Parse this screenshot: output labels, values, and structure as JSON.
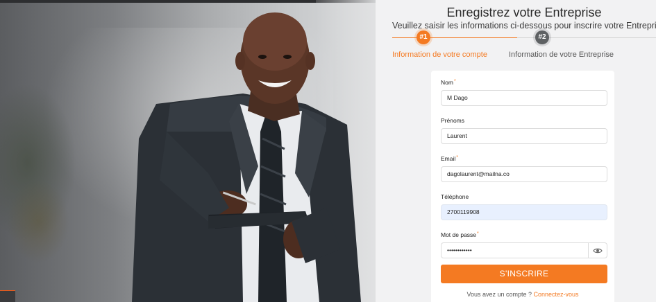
{
  "header": {
    "title": "Enregistrez votre Entreprise",
    "subtitle": "Veuillez saisir les informations ci-dessous pour inscrire votre Entreprise"
  },
  "steps": [
    {
      "number": "#1",
      "label": "Information de votre compte",
      "state": "active"
    },
    {
      "number": "#2",
      "label": "Information de votre Entreprise",
      "state": "inactive"
    }
  ],
  "form": {
    "nom": {
      "label": "Nom",
      "required_mark": "*",
      "value": "M Dago"
    },
    "prenoms": {
      "label": "Prénoms",
      "value": "Laurent"
    },
    "email": {
      "label": "Email",
      "required_mark": "*",
      "value": "dagolaurent@mailna.co"
    },
    "telephone": {
      "label": "Téléphone",
      "value": "2700119908"
    },
    "password": {
      "label": "Mot de passe",
      "required_mark": "*",
      "value": "••••••••••••"
    },
    "submit_label": "S'INSCRIRE",
    "login_prompt": "Vous avez un compte ?",
    "login_link": "Connectez-vous"
  },
  "icons": {
    "password_toggle": "eye-icon"
  },
  "colors": {
    "accent": "#f47a22",
    "step_inactive": "#5e6163",
    "autofill_bg": "#e8f0fe",
    "panel_bg": "#f2f2f3"
  }
}
